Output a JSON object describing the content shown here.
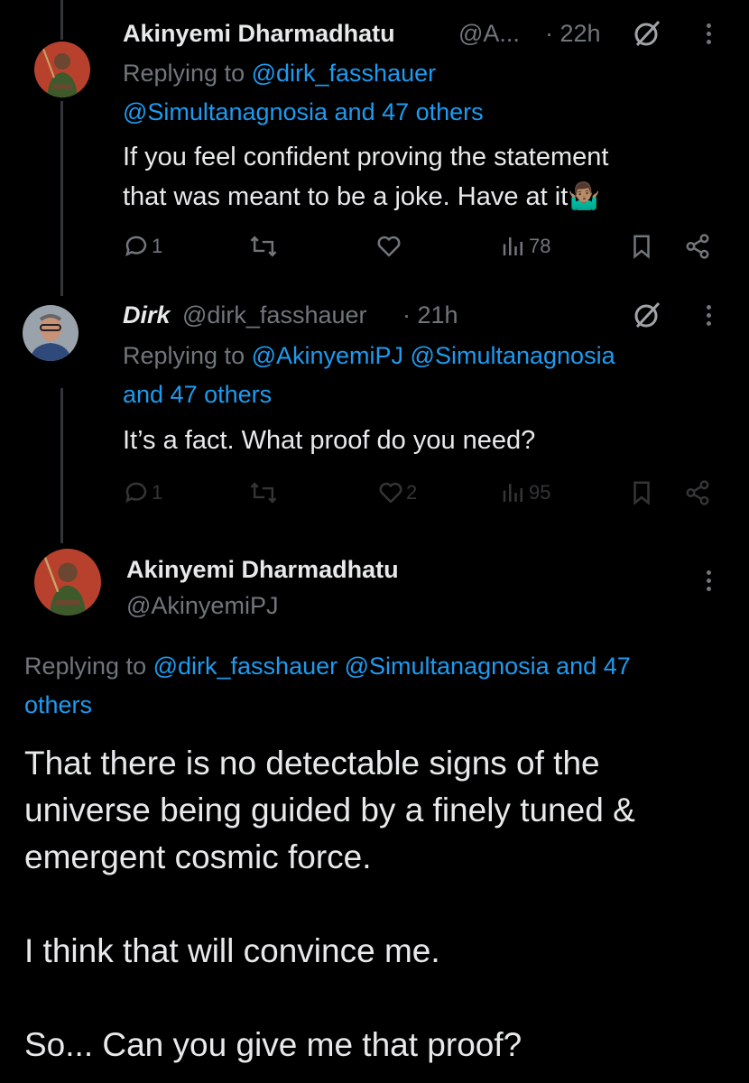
{
  "tweet1": {
    "display_name": "Akinyemi Dharmadhatu",
    "handle": "@A...",
    "time": "· 22h",
    "reply_prefix": "Replying to",
    "reply_to_line1": "@dirk_fasshauer",
    "reply_to_line2": "@Simultanagnosia and 47 others",
    "text_line1": "If you feel confident proving the statement",
    "text_line2": "that was meant to be a joke. Have at it🤷🏽‍♂️",
    "replies": "1",
    "likes": "",
    "views": "78"
  },
  "tweet2": {
    "display_name": "Dirk",
    "handle": "@dirk_fasshauer",
    "time": "· 21h",
    "reply_prefix": "Replying to",
    "reply_to_line1": "@AkinyemiPJ @Simultanagnosia",
    "reply_to_line2": "and 47 others",
    "text": "It’s a fact. What proof do you need?",
    "replies": "1",
    "likes": "2",
    "views": "95"
  },
  "main_tweet": {
    "display_name": "Akinyemi Dharmadhatu",
    "handle": "@AkinyemiPJ",
    "reply_prefix": "Replying to",
    "reply_to_line1": "@dirk_fasshauer @Simultanagnosia and 47",
    "reply_to_line2": "others",
    "text_line1": "That there is no detectable signs of the",
    "text_line2": "universe being guided by a finely tuned &",
    "text_line3": "emergent cosmic force.",
    "text_line4": "I think that will convince me.",
    "text_line5": "So... Can you give me that proof?"
  },
  "colors": {
    "background": "#000000",
    "text": "#e7e9ea",
    "muted": "#71767b",
    "link": "#1d9bf0"
  },
  "icons": [
    "reply-icon",
    "retweet-icon",
    "like-icon",
    "views-icon",
    "bookmark-icon",
    "share-icon",
    "grok-icon",
    "more-icon"
  ]
}
